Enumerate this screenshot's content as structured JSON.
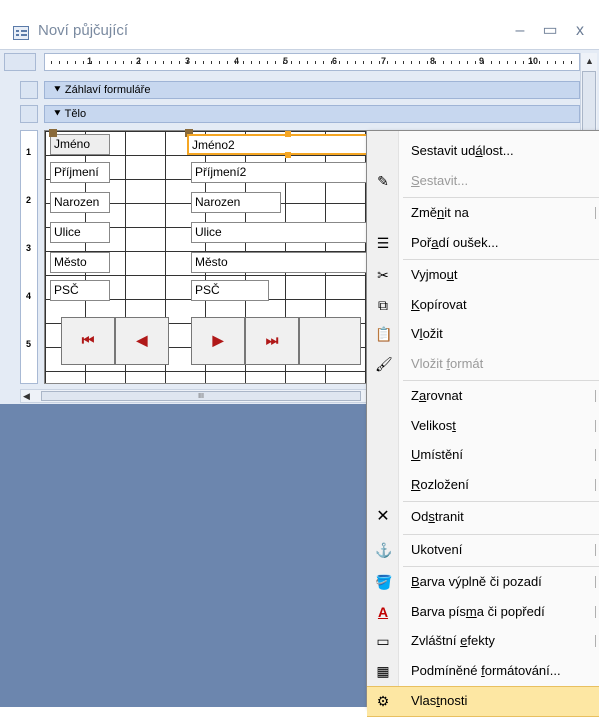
{
  "window": {
    "title": "Noví půjčující",
    "minimize": "–",
    "maximize": "▭",
    "close": "x"
  },
  "ruler": {
    "numbers": [
      "1",
      "2",
      "3",
      "4",
      "5",
      "6",
      "7",
      "8",
      "9",
      "10"
    ]
  },
  "vruler": {
    "numbers": [
      "1",
      "2",
      "3",
      "4",
      "5"
    ]
  },
  "sections": {
    "header": "Záhlaví formuláře",
    "body": "Tělo"
  },
  "form": {
    "labels": [
      "Jméno",
      "Příjmení",
      "Narozen",
      "Ulice",
      "Město",
      "PSČ"
    ],
    "fields": [
      "Jméno2",
      "Příjmení2",
      "Narozen",
      "Ulice",
      "Město",
      "PSČ"
    ],
    "nav": [
      "⏮",
      "◀",
      "▶",
      "⏭"
    ]
  },
  "hscroll": {
    "grip": "III"
  },
  "menu": {
    "items": [
      {
        "label": "Sestavit událost...",
        "ul": "á",
        "icon": "",
        "disabled": false,
        "submenu": false
      },
      {
        "label": "Sestavit...",
        "ul": "S",
        "icon": "✎",
        "disabled": true,
        "submenu": false
      },
      {
        "label": "Změnit na",
        "ul": "n",
        "icon": "",
        "disabled": false,
        "submenu": true
      },
      {
        "label": "Pořadí oušek...",
        "ul": "a",
        "icon": "☰",
        "disabled": false,
        "submenu": false
      },
      {
        "label": "Vyjmout",
        "ul": "u",
        "icon": "✂",
        "disabled": false,
        "submenu": false
      },
      {
        "label": "Kopírovat",
        "ul": "K",
        "icon": "⧉",
        "disabled": false,
        "submenu": false
      },
      {
        "label": "Vložit",
        "ul": "l",
        "icon": "📋",
        "disabled": false,
        "submenu": false
      },
      {
        "label": "Vložit formát",
        "ul": "f",
        "icon": "🖌",
        "disabled": true,
        "submenu": false
      },
      {
        "label": "Zarovnat",
        "ul": "a",
        "icon": "",
        "disabled": false,
        "submenu": true
      },
      {
        "label": "Velikost",
        "ul": "t",
        "icon": "",
        "disabled": false,
        "submenu": true
      },
      {
        "label": "Umístění",
        "ul": "U",
        "icon": "",
        "disabled": false,
        "submenu": true
      },
      {
        "label": "Rozložení",
        "ul": "R",
        "icon": "",
        "disabled": false,
        "submenu": true
      },
      {
        "label": "Odstranit",
        "ul": "s",
        "icon": "✕",
        "disabled": false,
        "submenu": false
      },
      {
        "label": "Ukotvení",
        "ul": "",
        "icon": "⚓",
        "disabled": false,
        "submenu": true
      },
      {
        "label": "Barva výplně či pozadí",
        "ul": "B",
        "icon": "🪣",
        "disabled": false,
        "submenu": true
      },
      {
        "label": "Barva písma či popředí",
        "ul": "m",
        "icon": "A",
        "disabled": false,
        "submenu": true
      },
      {
        "label": "Zvláštní efekty",
        "ul": "e",
        "icon": "▭",
        "disabled": false,
        "submenu": true
      },
      {
        "label": "Podmíněné formátování...",
        "ul": "f",
        "icon": "▦",
        "disabled": false,
        "submenu": false
      },
      {
        "label": "Vlastnosti",
        "ul": "t",
        "icon": "⚙",
        "disabled": false,
        "submenu": false,
        "highlight": true
      }
    ]
  },
  "colors": {
    "accent_selection": "#f5a623",
    "menu_highlight": "#fde7a3",
    "lower_background": "#6c86ae",
    "nav_arrow": "#b01818",
    "font_color_icon": "#c00000"
  }
}
